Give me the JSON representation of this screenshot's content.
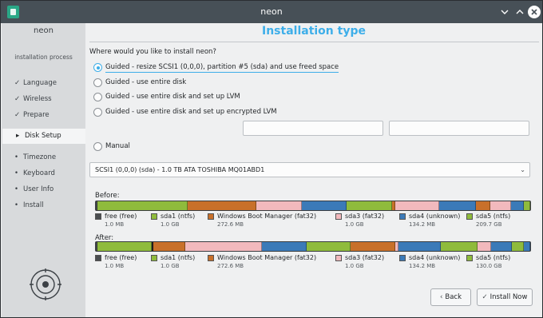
{
  "window": {
    "title": "neon"
  },
  "sidebar": {
    "brand": "neon",
    "phase": "installation process",
    "steps": [
      {
        "mark": "✓",
        "label": "Language"
      },
      {
        "mark": "✓",
        "label": "Wireless"
      },
      {
        "mark": "✓",
        "label": "Prepare"
      },
      {
        "mark": "▸",
        "label": "Disk Setup"
      },
      {
        "mark": "•",
        "label": "Timezone"
      },
      {
        "mark": "•",
        "label": "Keyboard"
      },
      {
        "mark": "•",
        "label": "User Info"
      },
      {
        "mark": "•",
        "label": "Install"
      }
    ]
  },
  "main": {
    "title": "Installation type",
    "question": "Where would you like to install neon?",
    "options": [
      {
        "label": "Guided - resize SCSI1 (0,0,0), partition #5 (sda) and use freed space",
        "checked": true
      },
      {
        "label": "Guided - use entire disk",
        "checked": false
      },
      {
        "label": "Guided - use entire disk and set up LVM",
        "checked": false
      },
      {
        "label": "Guided - use entire disk and set up encrypted LVM",
        "checked": false
      },
      {
        "label": "Manual",
        "checked": false
      }
    ],
    "passphrase_fields": [
      "",
      ""
    ],
    "disk_select": {
      "value": "SCSI1 (0,0,0) (sda) - 1.0 TB ATA TOSHIBA MQ01ABD1"
    },
    "before_label": "Before:",
    "after_label": "After:",
    "before_legend": [
      {
        "name": "free (free)",
        "size": "1.0 MB",
        "color": "#4a4d50"
      },
      {
        "name": "sda1 (ntfs)",
        "size": "1.0 GB",
        "color": "#8fbb3c"
      },
      {
        "name": "Windows Boot Manager (fat32)",
        "size": "272.6 MB",
        "color": "#c8702a"
      },
      {
        "name": "sda3 (fat32)",
        "size": "1.0 GB",
        "color": "#f2b9bd"
      },
      {
        "name": "sda4 (unknown)",
        "size": "134.2 MB",
        "color": "#3b7ab8"
      },
      {
        "name": "sda5 (ntfs)",
        "size": "209.7 GB",
        "color": "#8fbb3c"
      }
    ],
    "after_legend": [
      {
        "name": "free (free)",
        "size": "1.0 MB",
        "color": "#4a4d50"
      },
      {
        "name": "sda1 (ntfs)",
        "size": "1.0 GB",
        "color": "#8fbb3c"
      },
      {
        "name": "Windows Boot Manager (fat32)",
        "size": "272.6 MB",
        "color": "#c8702a"
      },
      {
        "name": "sda3 (fat32)",
        "size": "1.0 GB",
        "color": "#f2b9bd"
      },
      {
        "name": "sda4 (unknown)",
        "size": "134.2 MB",
        "color": "#3b7ab8"
      },
      {
        "name": "sda5 (ntfs)",
        "size": "130.0 GB",
        "color": "#8fbb3c"
      }
    ],
    "before_bar": [
      {
        "part": "free",
        "share": 0.4,
        "color": "#4a4d50"
      },
      {
        "part": "sda1",
        "share": 20.5,
        "color": "#8fbb3c"
      },
      {
        "part": "sda2",
        "share": 15.5,
        "color": "#c8702a"
      },
      {
        "part": "sda3",
        "share": 10.3,
        "color": "#f2b9bd"
      },
      {
        "part": "sda4",
        "share": 10.3,
        "color": "#3b7ab8"
      },
      {
        "part": "sda5",
        "share": 10.3,
        "color": "#8fbb3c"
      },
      {
        "part": "x",
        "share": 0.7,
        "color": "#c8702a"
      },
      {
        "part": "sda3",
        "share": 9.9,
        "color": "#f2b9bd"
      },
      {
        "part": "sda4",
        "share": 8.4,
        "color": "#3b7ab8"
      },
      {
        "part": "sda2",
        "share": 3.3,
        "color": "#c8702a"
      },
      {
        "part": "sda3",
        "share": 4.7,
        "color": "#f2b9bd"
      },
      {
        "part": "sda4",
        "share": 2.9,
        "color": "#3b7ab8"
      },
      {
        "part": "sda5",
        "share": 1.4,
        "color": "#8fbb3c"
      }
    ],
    "after_bar": [
      {
        "part": "free",
        "share": 0.4,
        "color": "#4a4d50"
      },
      {
        "part": "sda1",
        "share": 12.6,
        "color": "#8fbb3c"
      },
      {
        "part": "divider",
        "share": 0.4,
        "color": "#222222"
      },
      {
        "part": "sda2",
        "share": 7.4,
        "color": "#c8702a"
      },
      {
        "part": "sda3",
        "share": 17.7,
        "color": "#f2b9bd"
      },
      {
        "part": "sda4",
        "share": 10.3,
        "color": "#3b7ab8"
      },
      {
        "part": "sda5",
        "share": 10.3,
        "color": "#8fbb3c"
      },
      {
        "part": "sda2",
        "share": 10.3,
        "color": "#c8702a"
      },
      {
        "part": "x",
        "share": 0.7,
        "color": "#f2b9bd"
      },
      {
        "part": "sda4",
        "share": 9.9,
        "color": "#3b7ab8"
      },
      {
        "part": "sda5",
        "share": 8.4,
        "color": "#8fbb3c"
      },
      {
        "part": "sda3",
        "share": 3.3,
        "color": "#f2b9bd"
      },
      {
        "part": "sda4",
        "share": 4.7,
        "color": "#3b7ab8"
      },
      {
        "part": "sda5",
        "share": 2.9,
        "color": "#8fbb3c"
      },
      {
        "part": "sda4",
        "share": 1.4,
        "color": "#3b7ab8"
      }
    ],
    "back_label": "Back",
    "install_label": "Install Now"
  }
}
